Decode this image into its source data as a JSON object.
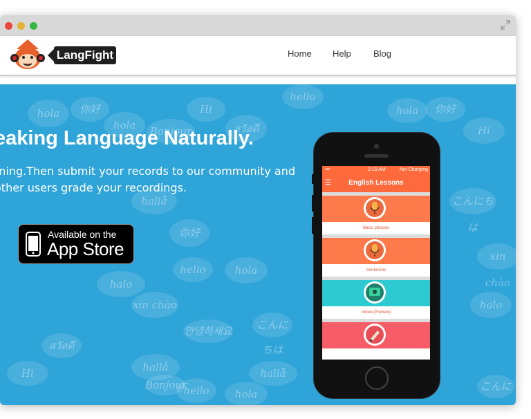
{
  "window": {
    "controls": [
      "close",
      "minimize",
      "zoom"
    ],
    "expand_icon": "expand-icon"
  },
  "nav": {
    "logo_text": "LangFight",
    "links": [
      "Home",
      "Help",
      "Blog"
    ]
  },
  "hero": {
    "title": "eaking Language Naturally.",
    "subtitle_line1": "rning.Then submit your records to our community and",
    "subtitle_line2": "other users grade your recordings.",
    "appstore_small": "Available on the",
    "appstore_big": "App Store",
    "background_words": [
      "hola",
      "你好",
      "hola",
      "Bonjour",
      "Hi",
      "สวัสดี",
      "hello",
      "hola",
      "你好",
      "Hi",
      "こんにちは",
      "xin chào",
      "halo",
      "hallå",
      "hello",
      "hola",
      "你好",
      "안녕하세요",
      "こんにちは",
      "xin chào",
      "halo",
      "hallå",
      "hello",
      "hola",
      "Hi",
      "สวัสดี",
      "Bonjour",
      "hallå",
      "こんにちは"
    ]
  },
  "phone": {
    "status_time": "2:18 AM",
    "status_charge": "Not Charging",
    "app_title": "English Lessons",
    "lessons": [
      {
        "label": "Basic phrases",
        "color": "#ff7a4b"
      },
      {
        "label": "Sentences",
        "color": "#ff7a4b"
      },
      {
        "label": "Video (Preview)",
        "color": "#2ecad1"
      },
      {
        "label": "",
        "color": "#f75d66"
      }
    ]
  },
  "colors": {
    "hero_blue": "#2ea4d8",
    "app_orange": "#ff6a3d"
  }
}
